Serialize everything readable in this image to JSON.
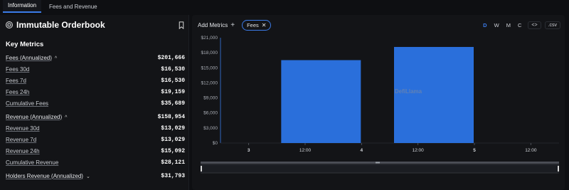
{
  "tabs": [
    {
      "label": "Information",
      "active": true
    },
    {
      "label": "Fees and Revenue",
      "active": false
    }
  ],
  "protocol": {
    "name": "Immutable Orderbook"
  },
  "key_metrics": {
    "title": "Key Metrics",
    "groups": [
      {
        "head": {
          "label": "Fees (Annualized)",
          "value": "$201,666",
          "chevron": "^"
        },
        "rows": [
          {
            "label": "Fees 30d",
            "value": "$16,530"
          },
          {
            "label": "Fees 7d",
            "value": "$16,530"
          },
          {
            "label": "Fees 24h",
            "value": "$19,159"
          },
          {
            "label": "Cumulative Fees",
            "value": "$35,689"
          }
        ]
      },
      {
        "head": {
          "label": "Revenue (Annualized)",
          "value": "$158,954",
          "chevron": "^"
        },
        "rows": [
          {
            "label": "Revenue 30d",
            "value": "$13,029"
          },
          {
            "label": "Revenue 7d",
            "value": "$13,029"
          },
          {
            "label": "Revenue 24h",
            "value": "$15,092"
          },
          {
            "label": "Cumulative Revenue",
            "value": "$28,121"
          }
        ]
      },
      {
        "head": {
          "label": "Holders Revenue (Annualized)",
          "value": "$31,793",
          "chevron": "v"
        },
        "rows": []
      }
    ]
  },
  "toolbar": {
    "add_metrics_label": "Add Metrics",
    "plus": "+",
    "chip_label": "Fees",
    "chip_close": "✕",
    "granularity": [
      {
        "label": "D",
        "active": true
      },
      {
        "label": "W",
        "active": false
      },
      {
        "label": "M",
        "active": false
      },
      {
        "label": "C",
        "active": false
      }
    ],
    "embed_label": "<>",
    "csv_label": ".csv"
  },
  "watermark": "DefiLlama",
  "colors": {
    "accent": "#3b7be8",
    "bar": "#2a6fdb"
  },
  "chart_data": {
    "type": "bar",
    "title": "",
    "xlabel": "",
    "ylabel": "",
    "ylim": [
      0,
      21000
    ],
    "yticks": [
      0,
      3000,
      6000,
      9000,
      12000,
      15000,
      18000,
      21000
    ],
    "ytick_labels": [
      "$0",
      "$3,000",
      "$6,000",
      "$9,000",
      "$12,000",
      "$15,000",
      "$18,000",
      "$21,000"
    ],
    "xticks": [
      "3",
      "12:00",
      "4",
      "12:00",
      "5",
      "12:00"
    ],
    "categories": [
      "4",
      "5"
    ],
    "values": [
      16530,
      19159
    ],
    "grid": false,
    "legend": "none"
  }
}
